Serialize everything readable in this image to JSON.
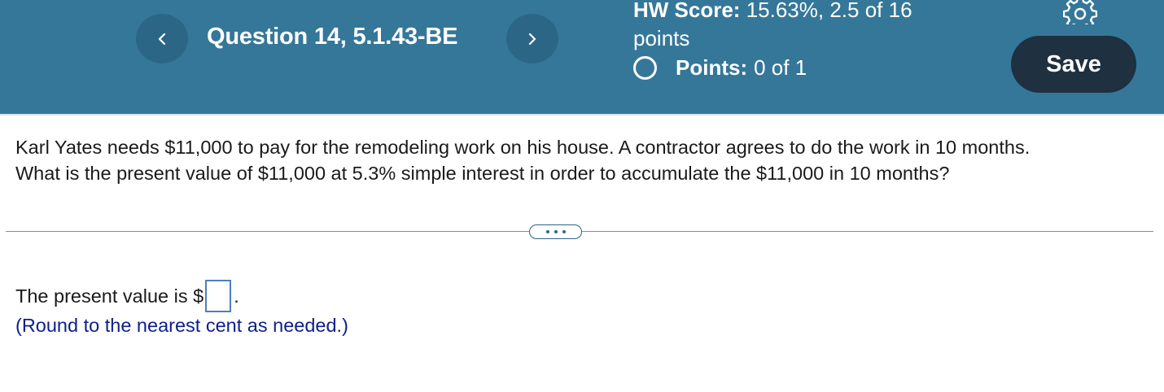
{
  "header": {
    "question_title": "Question 14, 5.1.43-BE",
    "hw_score_label": "HW Score:",
    "hw_score_value": "15.63%, 2.5 of 16",
    "hw_score_unit": "points",
    "points_label": "Points:",
    "points_value": "0 of 1",
    "save_label": "Save",
    "icons": {
      "prev": "chevron-left-icon",
      "next": "chevron-right-icon",
      "settings": "gear-icon",
      "status": "radio-circle-icon"
    },
    "colors": {
      "banner": "#357799",
      "nav_button": "#2c6686",
      "save_button": "#1f3040"
    }
  },
  "question": {
    "line1": "Karl Yates needs $11,000 to pay for the remodeling work on his house. A contractor agrees to do the work in 10 months.",
    "line2": "What is the present value of $11,000 at 5.3% simple interest in order to accumulate the $11,000 in 10 months?"
  },
  "answer": {
    "prefix": "The present value is $",
    "value": "",
    "suffix": ".",
    "hint": "(Round to the nearest cent as needed.)"
  }
}
